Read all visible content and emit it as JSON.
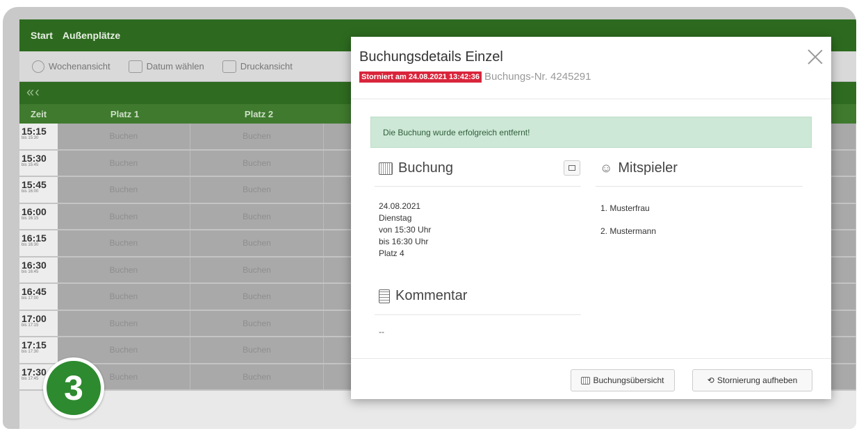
{
  "topnav": {
    "start": "Start",
    "aussen": "Außenplätze"
  },
  "toolbar": {
    "woche": "Wochenansicht",
    "datum": "Datum wählen",
    "druck": "Druckansicht"
  },
  "navbar": {
    "arrows": "«‹"
  },
  "grid": {
    "col_zeit": "Zeit",
    "col_platz1": "Platz 1",
    "col_platz2": "Platz 2",
    "book_label": "Buchen",
    "rows": [
      {
        "time": "15:15",
        "bis": "bis 15:30"
      },
      {
        "time": "15:30",
        "bis": "bis 15:45"
      },
      {
        "time": "15:45",
        "bis": "bis 16:00"
      },
      {
        "time": "16:00",
        "bis": "bis 16:15"
      },
      {
        "time": "16:15",
        "bis": "bis 16:30"
      },
      {
        "time": "16:30",
        "bis": "bis 16:45"
      },
      {
        "time": "16:45",
        "bis": "bis 17:00"
      },
      {
        "time": "17:00",
        "bis": "bis 17:15"
      },
      {
        "time": "17:15",
        "bis": "bis 17:30"
      },
      {
        "time": "17:30",
        "bis": "bis 17:45"
      }
    ]
  },
  "badge": "3",
  "modal": {
    "title": "Buchungsdetails Einzel",
    "storno": "Storniert am 24.08.2021 13:42:36",
    "booking_nr": "Buchungs-Nr. 4245291",
    "alert": "Die Buchung wurde erfolgreich entfernt!",
    "buchung_heading": "Buchung",
    "mitspieler_heading": "Mitspieler",
    "details": [
      "24.08.2021",
      "Dienstag",
      "von 15:30 Uhr",
      "bis 16:30 Uhr",
      "Platz 4"
    ],
    "players": [
      "1. Musterfrau",
      "2. Mustermann"
    ],
    "kommentar_heading": "Kommentar",
    "kommentar": "--",
    "btn_overview": "Buchungsübersicht",
    "btn_restore": "Stornierung aufheben"
  }
}
